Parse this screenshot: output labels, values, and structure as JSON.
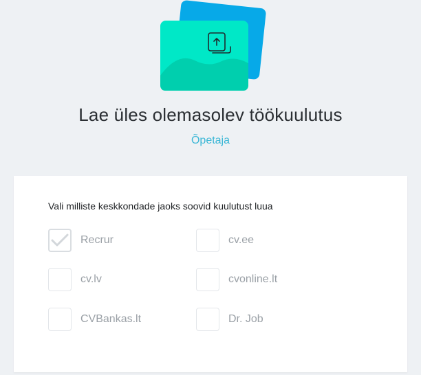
{
  "page": {
    "title": "Lae üles olemasolev töökuulutus",
    "subtitle": "Õpetaja"
  },
  "form": {
    "prompt": "Vali milliste keskkondade jaoks soovid kuulutust luua",
    "options": [
      {
        "label": "Recrur",
        "checked": true
      },
      {
        "label": "cv.ee",
        "checked": false
      },
      {
        "label": "cv.lv",
        "checked": false
      },
      {
        "label": "cvonline.lt",
        "checked": false
      },
      {
        "label": "CVBankas.lt",
        "checked": false
      },
      {
        "label": "Dr. Job",
        "checked": false
      }
    ]
  },
  "icons": {
    "hero": "upload-document-illustration",
    "check": "checkmark-icon"
  },
  "colors": {
    "background": "#eef1f4",
    "accent_blue": "#07a9e8",
    "accent_teal": "#00e8c7",
    "subtitle": "#3bb7d6",
    "muted_text": "#9aa0a6"
  }
}
